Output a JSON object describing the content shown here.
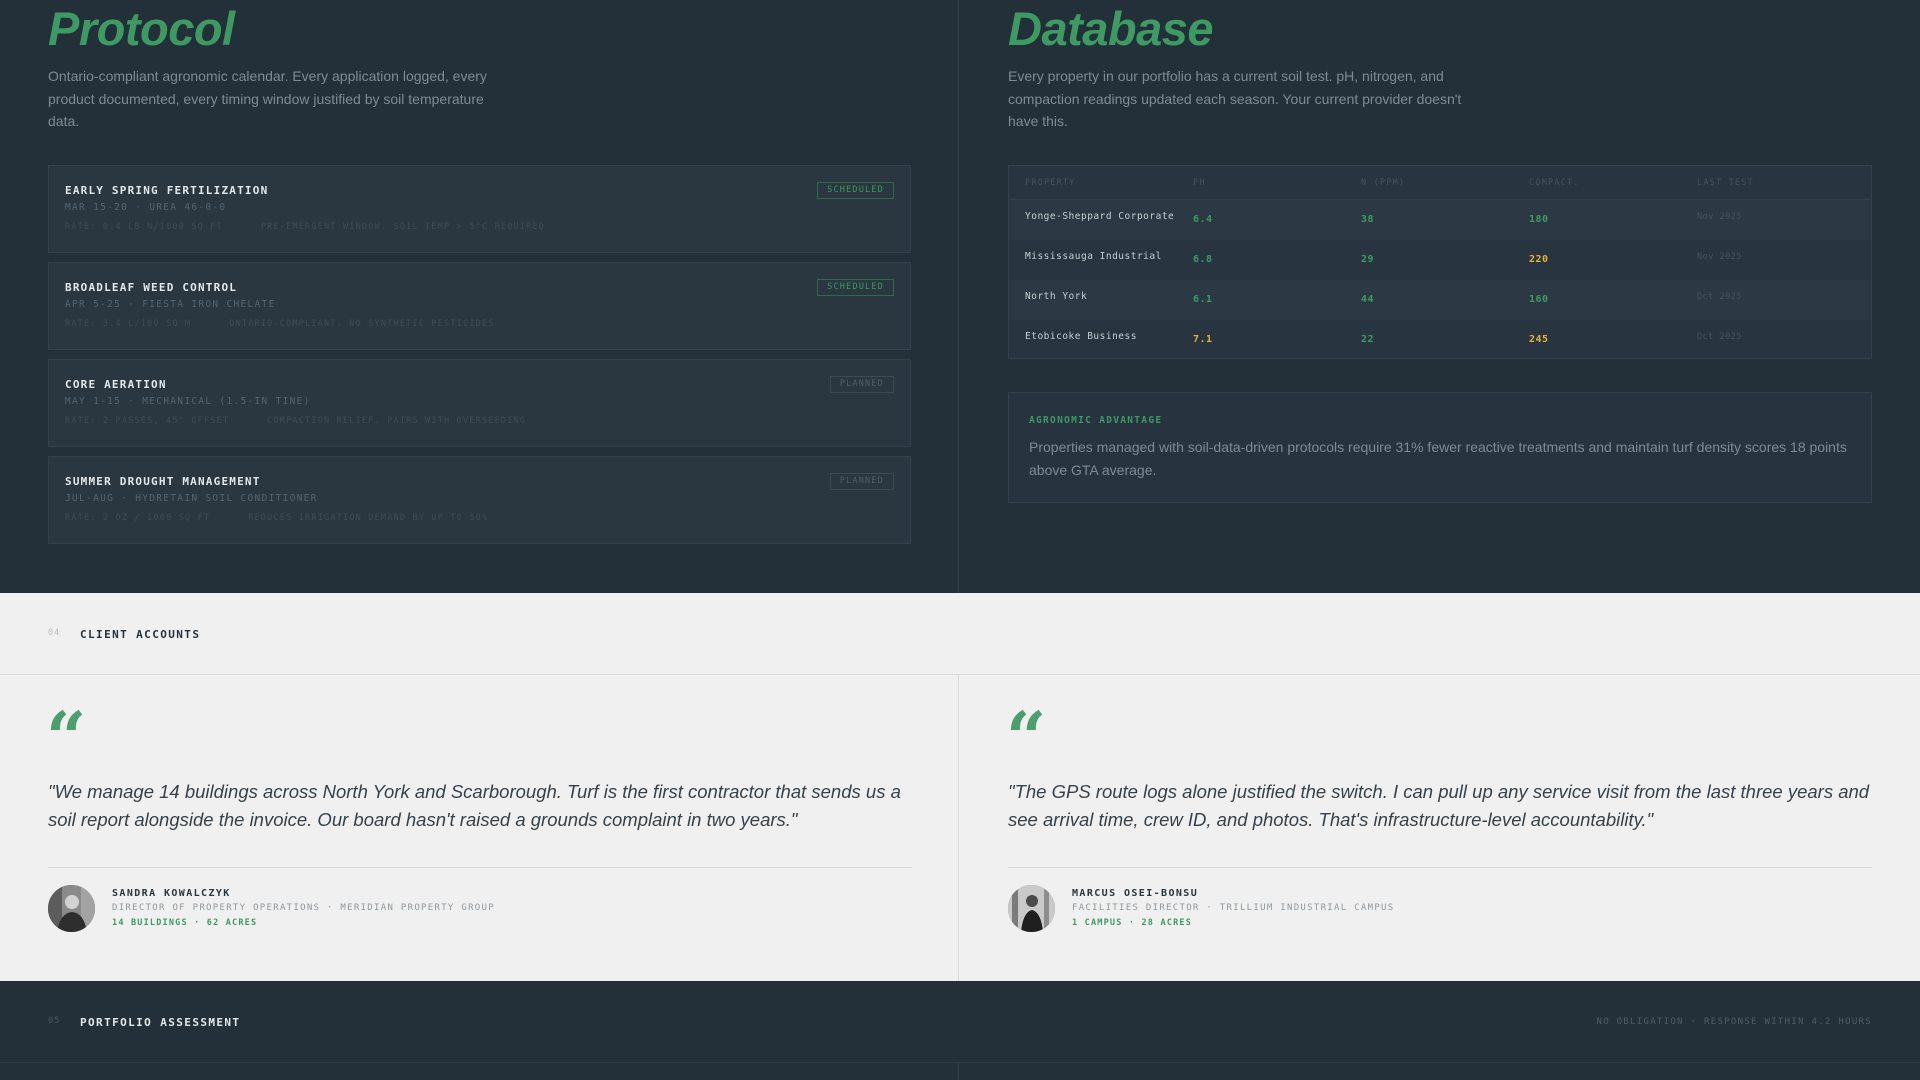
{
  "protocol": {
    "title": "Protocol",
    "description": "Ontario-compliant agronomic calendar. Every application logged, every product documented, every timing window justified by soil temperature data.",
    "cards": [
      {
        "title": "EARLY SPRING FERTILIZATION",
        "sub": "MAR 15-20 · UREA 46-0-0",
        "meta": "RATE: 0.4 LB N/1000 SQ FT      PRE-EMERGENT WINDOW. SOIL TEMP > 5°C REQUIRED",
        "badge": "SCHEDULED",
        "status": "scheduled"
      },
      {
        "title": "BROADLEAF WEED CONTROL",
        "sub": "APR 5-25 · FIESTA IRON CHELATE",
        "meta": "RATE: 3.4 L/100 SQ M      ONTARIO-COMPLIANT. NO SYNTHETIC PESTICIDES",
        "badge": "SCHEDULED",
        "status": "scheduled"
      },
      {
        "title": "CORE AERATION",
        "sub": "MAY 1-15 · MECHANICAL (1.5-IN TINE)",
        "meta": "RATE: 2 PASSES, 45° OFFSET      COMPACTION RELIEF. PAIRS WITH OVERSEEDING",
        "badge": "PLANNED",
        "status": "planned"
      },
      {
        "title": "SUMMER DROUGHT MANAGEMENT",
        "sub": "JUL-AUG · HYDRETAIN SOIL CONDITIONER",
        "meta": "RATE: 2 OZ / 1000 SQ FT      REDUCES IRRIGATION DEMAND BY UP TO 50%",
        "badge": "PLANNED",
        "status": "planned"
      }
    ]
  },
  "database": {
    "title": "Database",
    "description": "Every property in our portfolio has a current soil test. pH, nitrogen, and compaction readings updated each season. Your current provider doesn't have this.",
    "columns": [
      "PROPERTY",
      "PH",
      "N (PPM)",
      "COMPACT.",
      "LAST TEST"
    ],
    "rows": [
      {
        "property": "Yonge-Sheppard Corporate",
        "ph": "6.4",
        "n": "38",
        "compact": "180",
        "last_test": "Nov 2025",
        "ph_status": "green",
        "compact_status": "green"
      },
      {
        "property": "Mississauga Industrial",
        "ph": "6.8",
        "n": "29",
        "compact": "220",
        "last_test": "Nov 2025",
        "ph_status": "green",
        "compact_status": "amber"
      },
      {
        "property": "North York",
        "ph": "6.1",
        "n": "44",
        "compact": "160",
        "last_test": "Oct 2025",
        "ph_status": "green",
        "compact_status": "green"
      },
      {
        "property": "Etobicoke Business",
        "ph": "7.1",
        "n": "22",
        "compact": "245",
        "last_test": "Oct 2025",
        "ph_status": "amber",
        "compact_status": "amber"
      }
    ],
    "advantage_label": "AGRONOMIC ADVANTAGE",
    "advantage_text": "Properties managed with soil-data-driven protocols require 31% fewer reactive treatments and maintain turf density scores 18 points above GTA average."
  },
  "clients": {
    "section_num": "04",
    "section_title": "CLIENT ACCOUNTS",
    "quote_mark": "“",
    "testimonials": [
      {
        "quote": "\"We manage 14 buildings across North York and Scarborough. Turf is the first contractor that sends us a soil report alongside the invoice. Our board hasn't raised a grounds complaint in two years.\"",
        "name": "SANDRA KOWALCZYK",
        "role": "DIRECTOR OF PROPERTY OPERATIONS · MERIDIAN PROPERTY GROUP",
        "stats": "14 BUILDINGS · 62 ACRES"
      },
      {
        "quote": "\"The GPS route logs alone justified the switch. I can pull up any service visit from the last three years and see arrival time, crew ID, and photos. That's infrastructure-level accountability.\"",
        "name": "MARCUS OSEI-BONSU",
        "role": "FACILITIES DIRECTOR · TRILLIUM INDUSTRIAL CAMPUS",
        "stats": "1 CAMPUS · 28 ACRES"
      }
    ]
  },
  "portfolio": {
    "section_num": "05",
    "section_title": "PORTFOLIO ASSESSMENT",
    "note": "NO OBLIGATION · RESPONSE WITHIN 4.2 HOURS"
  },
  "colors": {
    "accent_green": "#3d9a62",
    "warning_amber": "#e2b33c",
    "dark_bg": "#243039",
    "light_bg": "#f0f0f0"
  }
}
